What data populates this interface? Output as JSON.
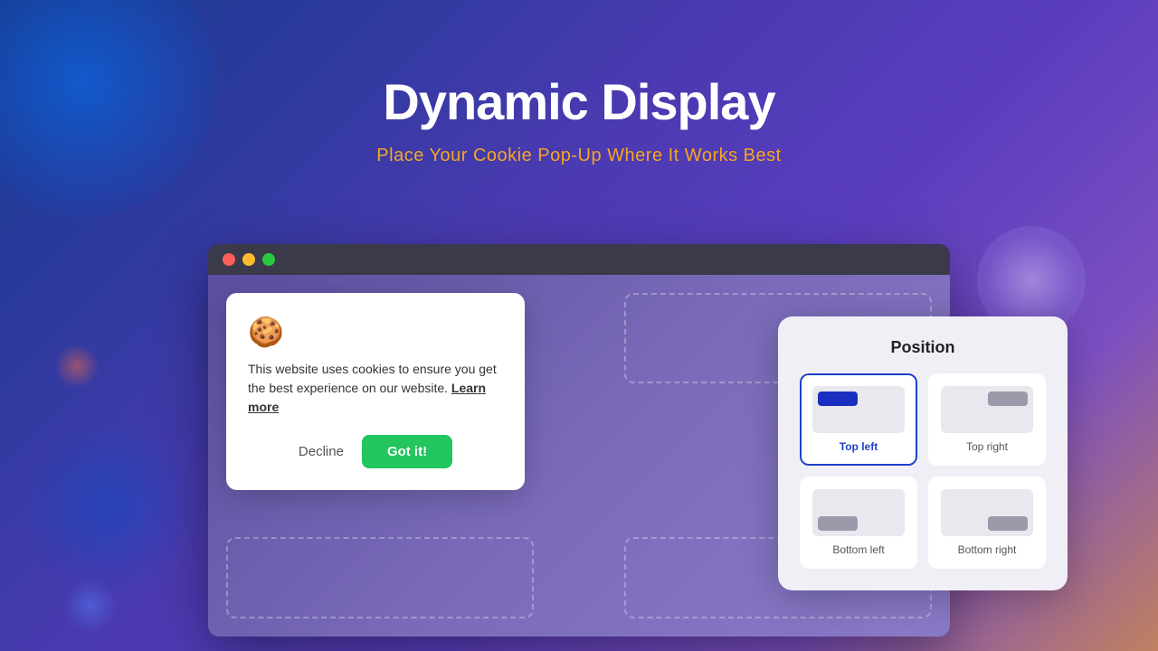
{
  "header": {
    "title": "Dynamic Display",
    "subtitle": "Place Your Cookie Pop-Up Where It Works Best"
  },
  "browser": {
    "traffic_lights": [
      "red",
      "yellow",
      "green"
    ]
  },
  "cookie_popup": {
    "icon": "🍪",
    "text": "This website uses cookies to ensure you get the best experience on our website.",
    "learn_more": "Learn more",
    "decline_label": "Decline",
    "got_it_label": "Got it!"
  },
  "position_panel": {
    "title": "Position",
    "options": [
      {
        "id": "top-left",
        "label": "Top left",
        "active": true
      },
      {
        "id": "top-right",
        "label": "Top right",
        "active": false
      },
      {
        "id": "bottom-left",
        "label": "Bottom left",
        "active": false
      },
      {
        "id": "bottom-right",
        "label": "Bottom right",
        "active": false
      }
    ]
  }
}
